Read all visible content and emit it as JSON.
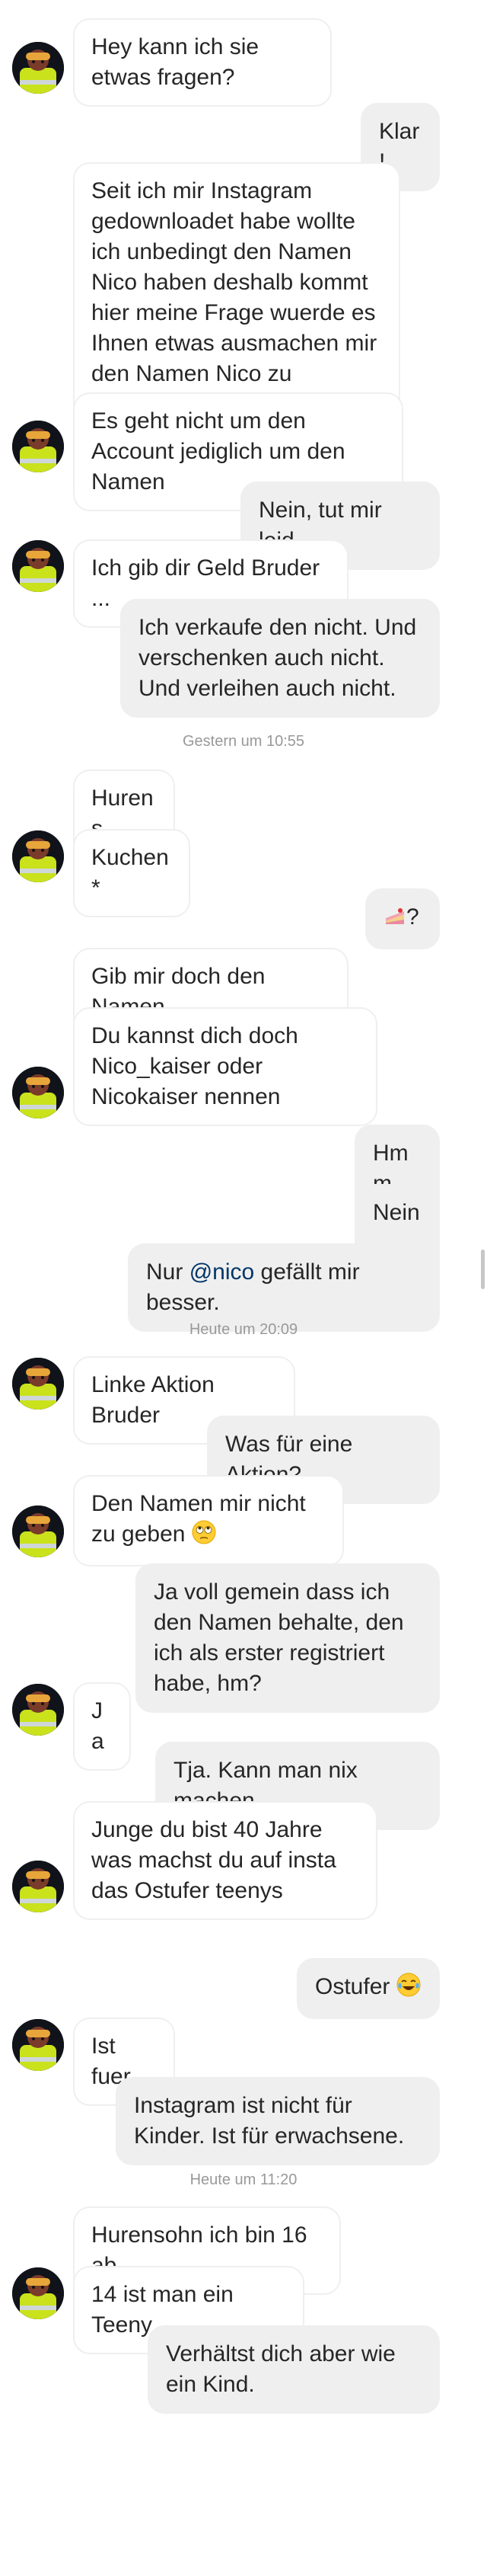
{
  "conversation": {
    "messages": [
      {
        "text": "Hey kann ich sie etwas fragen?"
      },
      {
        "text": "Klar!"
      },
      {
        "text": "Seit ich mir Instagram gedownloadet habe wollte ich unbedingt den Namen Nico haben deshalb kommt hier meine Frage wuerde es Ihnen etwas ausmachen mir den Namen Nico zu überlassen"
      },
      {
        "text": "Es geht nicht um den Account jediglich um den Namen"
      },
      {
        "text": "Nein, tut mir leid."
      },
      {
        "text": "Ich gib dir Geld Bruder ..."
      },
      {
        "text": "Ich verkaufe den nicht. Und verschenken auch nicht. Und verleihen auch nicht."
      },
      {
        "text": "Hurens"
      },
      {
        "text": "Kuchen*"
      },
      {
        "text": "?"
      },
      {
        "text": "Gib mir doch den Namen"
      },
      {
        "text": "Du kannst dich doch Nico_kaiser oder Nicokaiser nennen"
      },
      {
        "text": "Hmm"
      },
      {
        "text": "Nein."
      },
      {
        "text_before": "Nur ",
        "mention": "@nico",
        "text_after": " gefällt mir besser."
      },
      {
        "text": "Linke Aktion Bruder"
      },
      {
        "text": "Was für eine Aktion?"
      },
      {
        "text": "Den Namen mir nicht zu geben"
      },
      {
        "text": "Ja voll gemein dass ich den Namen behalte, den ich als erster registriert habe, hm?"
      },
      {
        "text": "Ja"
      },
      {
        "text": "Tja. Kann man nix machen."
      },
      {
        "text": "Junge du bist 40 Jahre was machst du auf insta das Ostufer teenys"
      },
      {
        "text": "Ostufer"
      },
      {
        "text": "Ist fuer"
      },
      {
        "text": "Instagram ist nicht für Kinder. Ist für erwachsene."
      },
      {
        "text": "Hurensohn ich bin 16 ab"
      },
      {
        "text": "14 ist man ein Teeny"
      },
      {
        "text": "Verhältst dich aber wie ein Kind."
      }
    ],
    "timestamps": [
      "Gestern um 10:55",
      "Heute um 20:09",
      "Heute um 11:20"
    ]
  }
}
